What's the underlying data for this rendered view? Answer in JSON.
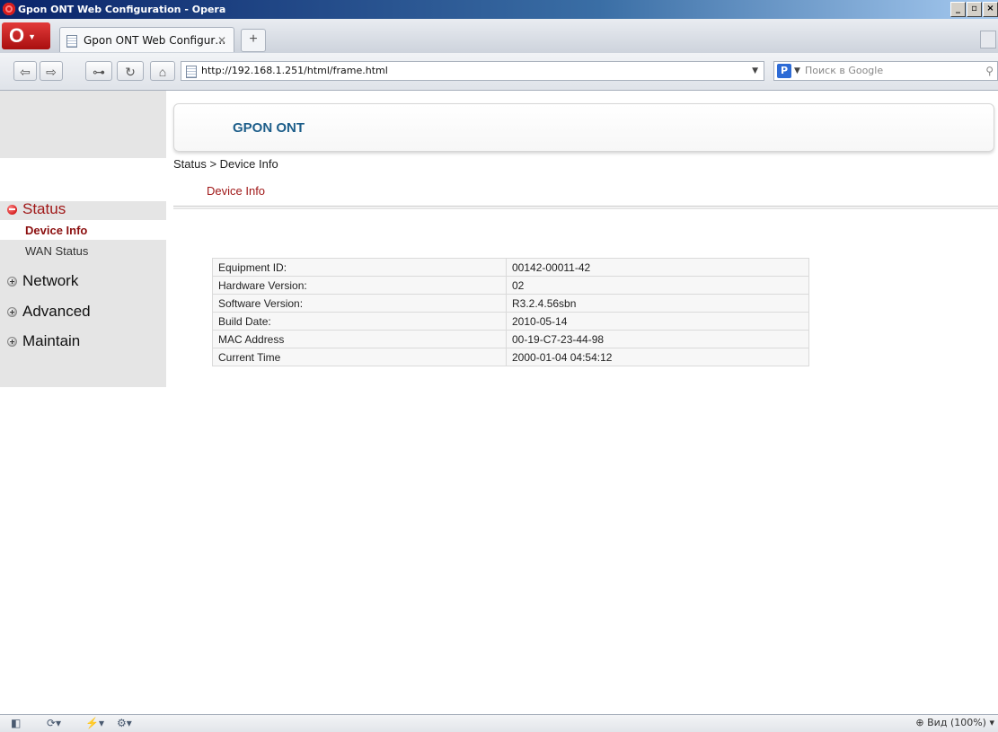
{
  "window": {
    "title": "Gpon ONT Web Configuration - Opera",
    "controls": [
      "_",
      "▫",
      "×"
    ]
  },
  "browser": {
    "tab_title": "Gpon ONT Web Configur…",
    "url": "http://192.168.1.251/html/frame.html",
    "search_placeholder": "Поиск в Google",
    "zoom_label": "Вид (100%)"
  },
  "page": {
    "brand": "GPON ONT",
    "breadcrumb": "Status > Device Info",
    "section_title": "Device Info"
  },
  "sidebar": {
    "menus": [
      {
        "label": "Status",
        "expanded": true
      },
      {
        "label": "Network",
        "expanded": false
      },
      {
        "label": "Advanced",
        "expanded": false
      },
      {
        "label": "Maintain",
        "expanded": false
      }
    ],
    "status_items": [
      {
        "label": "Device Info",
        "active": true
      },
      {
        "label": "WAN Status",
        "active": false
      }
    ]
  },
  "device_info": [
    {
      "label": "Equipment ID:",
      "value": "00142-00011-42"
    },
    {
      "label": "Hardware Version:",
      "value": "02"
    },
    {
      "label": "Software Version:",
      "value": "R3.2.4.56sbn"
    },
    {
      "label": "Build Date:",
      "value": "2010-05-14"
    },
    {
      "label": "MAC Address",
      "value": "00-19-C7-23-44-98"
    },
    {
      "label": "Current Time",
      "value": "2000-01-04 04:54:12"
    }
  ]
}
